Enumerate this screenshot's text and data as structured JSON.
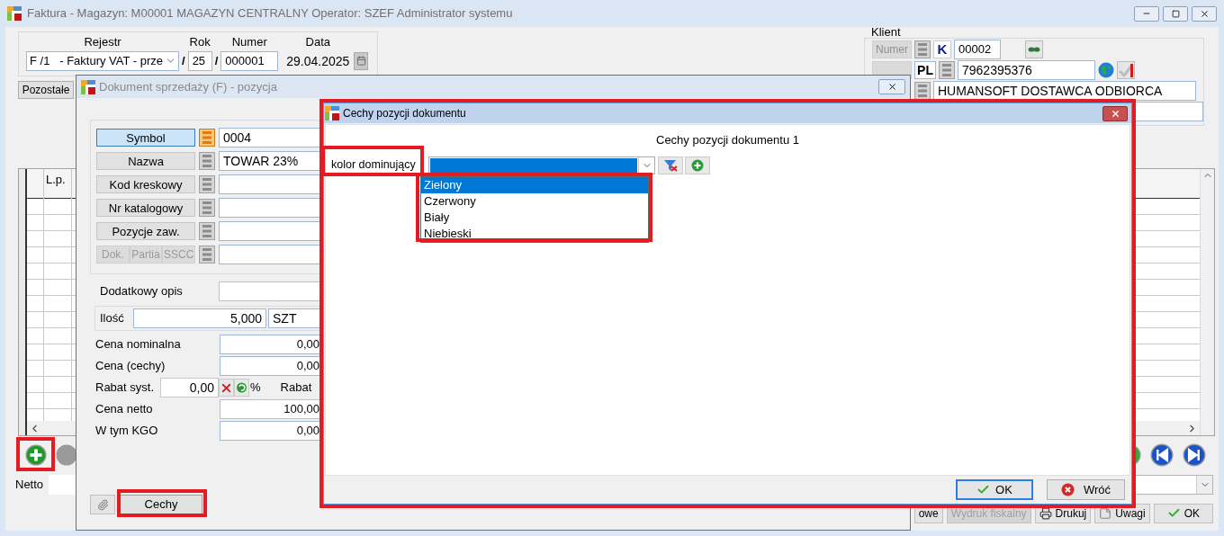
{
  "main_window": {
    "title": "Faktura - Magazyn: M00001 MAGAZYN CENTRALNY  Operator: SZEF Administrator systemu",
    "document_header": {
      "register_label": "Rejestr",
      "register_value": "F /1   - Faktury VAT - prze",
      "separator": "/",
      "year_label": "Rok",
      "year_value": "25",
      "number_label": "Numer",
      "number_value": "000001",
      "date_label": "Data",
      "date_value": "29.04.2025"
    },
    "other_button": "Pozostałe",
    "client": {
      "group_label": "Klient",
      "number_button": {
        "label": "Numer",
        "disabled": true
      },
      "kind_code": "K",
      "number_value": "00002",
      "country_code": "PL",
      "nip_value": "7962395376",
      "name_value": "HUMANSOFT DOSTAWCA ODBIORCA"
    },
    "table": {
      "columns": [
        "L.p."
      ]
    },
    "netto_label": "Netto",
    "footer_buttons": [
      {
        "label": "owe",
        "kind": "plain",
        "disabled": false
      },
      {
        "label": "Wydruk fiskalny",
        "kind": "plain",
        "disabled": true
      },
      {
        "label": "Drukuj",
        "kind": "print",
        "disabled": false
      },
      {
        "label": "Uwagi",
        "kind": "note",
        "disabled": false
      },
      {
        "label": "OK",
        "kind": "confirm",
        "disabled": false
      }
    ]
  },
  "position_dialog": {
    "title": "Dokument sprzedaży (F) - pozycja",
    "lookup_buttons": [
      {
        "label": "Symbol",
        "selected": true,
        "value": "0004"
      },
      {
        "label": "Nazwa",
        "selected": false,
        "value": "TOWAR 23%"
      },
      {
        "label": "Kod kreskowy",
        "selected": false
      },
      {
        "label": "Nr katalogowy",
        "selected": false
      },
      {
        "label": "Pozycje zaw.",
        "selected": false
      }
    ],
    "source_buttons": [
      {
        "label": "Dok.",
        "disabled": true
      },
      {
        "label": "Partia",
        "disabled": true
      },
      {
        "label": "SSCC",
        "disabled": true
      }
    ],
    "description_label": "Dodatkowy opis",
    "quantity_label": "Ilość",
    "quantity_value": "5,000",
    "unit_value": "SZT",
    "price_rows": [
      {
        "kind": "price",
        "label": "Cena nominalna",
        "value": "0,00",
        "editable": false
      },
      {
        "kind": "price",
        "label": "Cena (cechy)",
        "value": "0,00",
        "editable": false
      },
      {
        "kind": "discount",
        "label": "Rabat syst.",
        "value": "0,00",
        "percent_sign": "%",
        "next_label": "Rabat"
      },
      {
        "kind": "price",
        "label": "Cena netto",
        "value": "100,00",
        "editable": true
      },
      {
        "kind": "price",
        "label": "W tym KGO",
        "value": "0,00",
        "editable": false
      }
    ],
    "features_button": "Cechy"
  },
  "features_dialog": {
    "title": "Cechy pozycji dokumentu",
    "heading": "Cechy pozycji dokumentu 1",
    "feature_label": "kolor dominujący",
    "options": [
      {
        "label": "Zielony",
        "selected": true
      },
      {
        "label": "Czerwony",
        "selected": false
      },
      {
        "label": "Biały",
        "selected": false
      },
      {
        "label": "Niebieski",
        "selected": false
      }
    ],
    "ok_button": "OK",
    "back_button": "Wróć"
  }
}
